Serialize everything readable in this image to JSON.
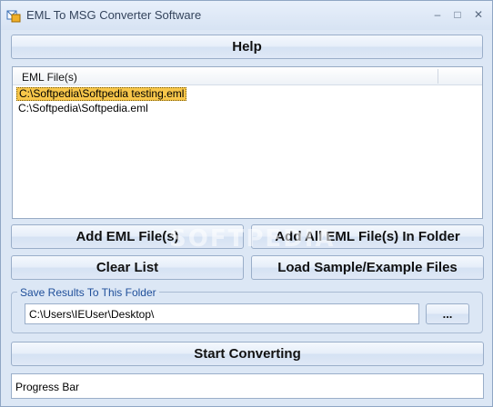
{
  "window": {
    "title": "EML To MSG Converter Software",
    "controls": {
      "minimize": "–",
      "maximize": "□",
      "close": "✕"
    }
  },
  "buttons": {
    "help": "Help",
    "add_files": "Add EML File(s)",
    "add_folder": "Add All EML File(s) In Folder",
    "clear_list": "Clear List",
    "load_sample": "Load Sample/Example Files",
    "browse": "...",
    "start": "Start Converting"
  },
  "file_list": {
    "column_header": "EML File(s)",
    "items": [
      {
        "path": "C:\\Softpedia\\Softpedia testing.eml",
        "selected": true
      },
      {
        "path": "C:\\Softpedia\\Softpedia.eml",
        "selected": false
      }
    ]
  },
  "output_folder": {
    "label": "Save Results To This Folder",
    "value": "C:\\Users\\IEUser\\Desktop\\"
  },
  "progress": {
    "label": "Progress Bar"
  },
  "watermark": "SOFTPEDIA",
  "colors": {
    "window_bg": "#dce7f5",
    "selection": "#f7c64a",
    "group_label": "#1f4f9a",
    "button_border": "#9aaec9"
  }
}
